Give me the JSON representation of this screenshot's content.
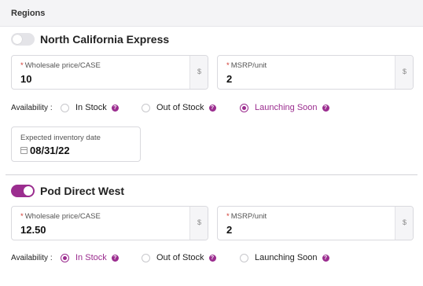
{
  "section_title": "Regions",
  "availability_label": "Availability :",
  "regions": [
    {
      "name": "North California Express",
      "enabled": false,
      "wholesale": {
        "label": "Wholesale price/CASE",
        "value": "10",
        "suffix": "$"
      },
      "msrp": {
        "label": "MSRP/unit",
        "value": "2",
        "suffix": "$"
      },
      "options": [
        {
          "label": "In Stock",
          "selected": false
        },
        {
          "label": "Out of Stock",
          "selected": false
        },
        {
          "label": "Launching Soon",
          "selected": true
        }
      ],
      "expected_date": {
        "label": "Expected inventory date",
        "value": "08/31/22"
      }
    },
    {
      "name": "Pod Direct West",
      "enabled": true,
      "wholesale": {
        "label": "Wholesale price/CASE",
        "value": "12.50",
        "suffix": "$"
      },
      "msrp": {
        "label": "MSRP/unit",
        "value": "2",
        "suffix": "$"
      },
      "options": [
        {
          "label": "In Stock",
          "selected": true
        },
        {
          "label": "Out of Stock",
          "selected": false
        },
        {
          "label": "Launching Soon",
          "selected": false
        }
      ]
    }
  ],
  "required_marker": "*",
  "help_glyph": "?",
  "colors": {
    "accent": "#9b2d8f",
    "required": "#d0342c"
  }
}
